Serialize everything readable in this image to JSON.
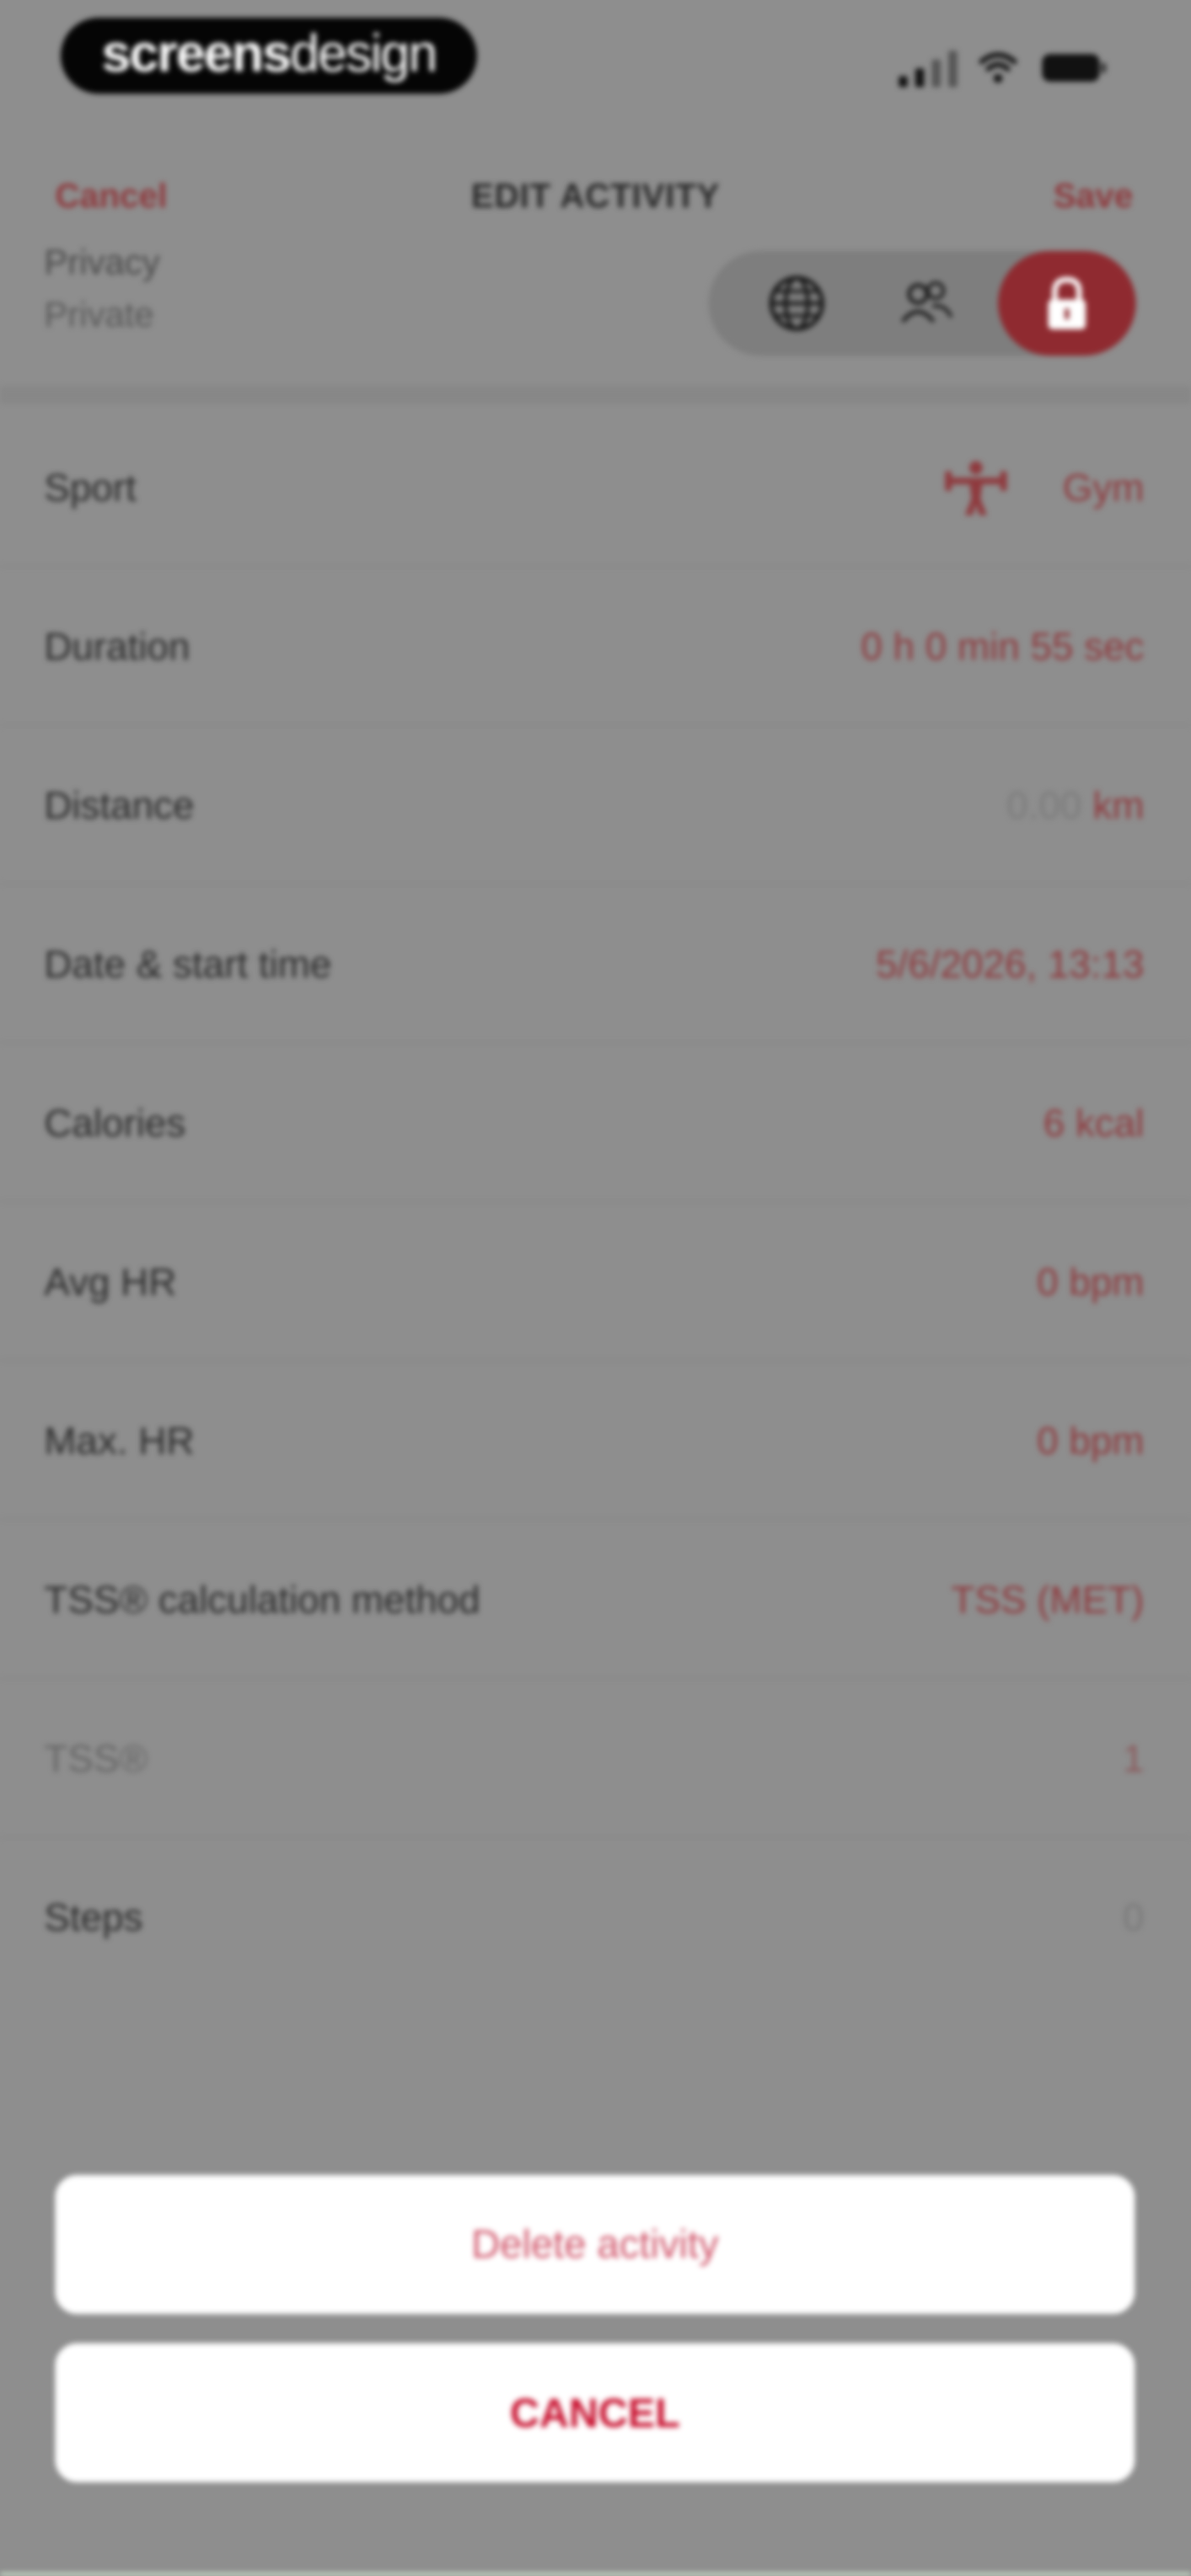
{
  "status_bar": {
    "brand_bold": "screens",
    "brand_light": "design",
    "icons": [
      "signal-icon",
      "wifi-icon",
      "battery-icon"
    ]
  },
  "nav": {
    "cancel_label": "Cancel",
    "title": "EDIT ACTIVITY",
    "save_label": "Save"
  },
  "privacy": {
    "label": "Privacy",
    "value": "Private",
    "options": [
      "globe-icon",
      "friends-icon",
      "lock-icon"
    ],
    "selected": "lock-icon"
  },
  "rows": [
    {
      "label": "Sport",
      "value": "Gym",
      "icon": "gym-icon"
    },
    {
      "label": "Duration",
      "value": "0 h 0 min 55 sec"
    },
    {
      "label": "Distance",
      "placeholder": "0.00",
      "unit": "km"
    },
    {
      "label": "Date & start time",
      "value": "5/6/2026, 13:13"
    },
    {
      "label": "Calories",
      "value": "6 kcal"
    },
    {
      "label": "Avg HR",
      "value": "0 bpm"
    },
    {
      "label": "Max. HR",
      "value": "0 bpm"
    },
    {
      "label": "TSS® calculation method",
      "value": "TSS (MET)"
    },
    {
      "label": "TSS®",
      "value": "1"
    },
    {
      "label": "Steps",
      "value": "0"
    }
  ],
  "sheet": {
    "delete_label": "Delete activity",
    "cancel_label": "CANCEL"
  },
  "colors": {
    "accent": "#c8102e",
    "dimmed_accent": "#8f3a3e",
    "overlay": "#8e8e8e"
  }
}
